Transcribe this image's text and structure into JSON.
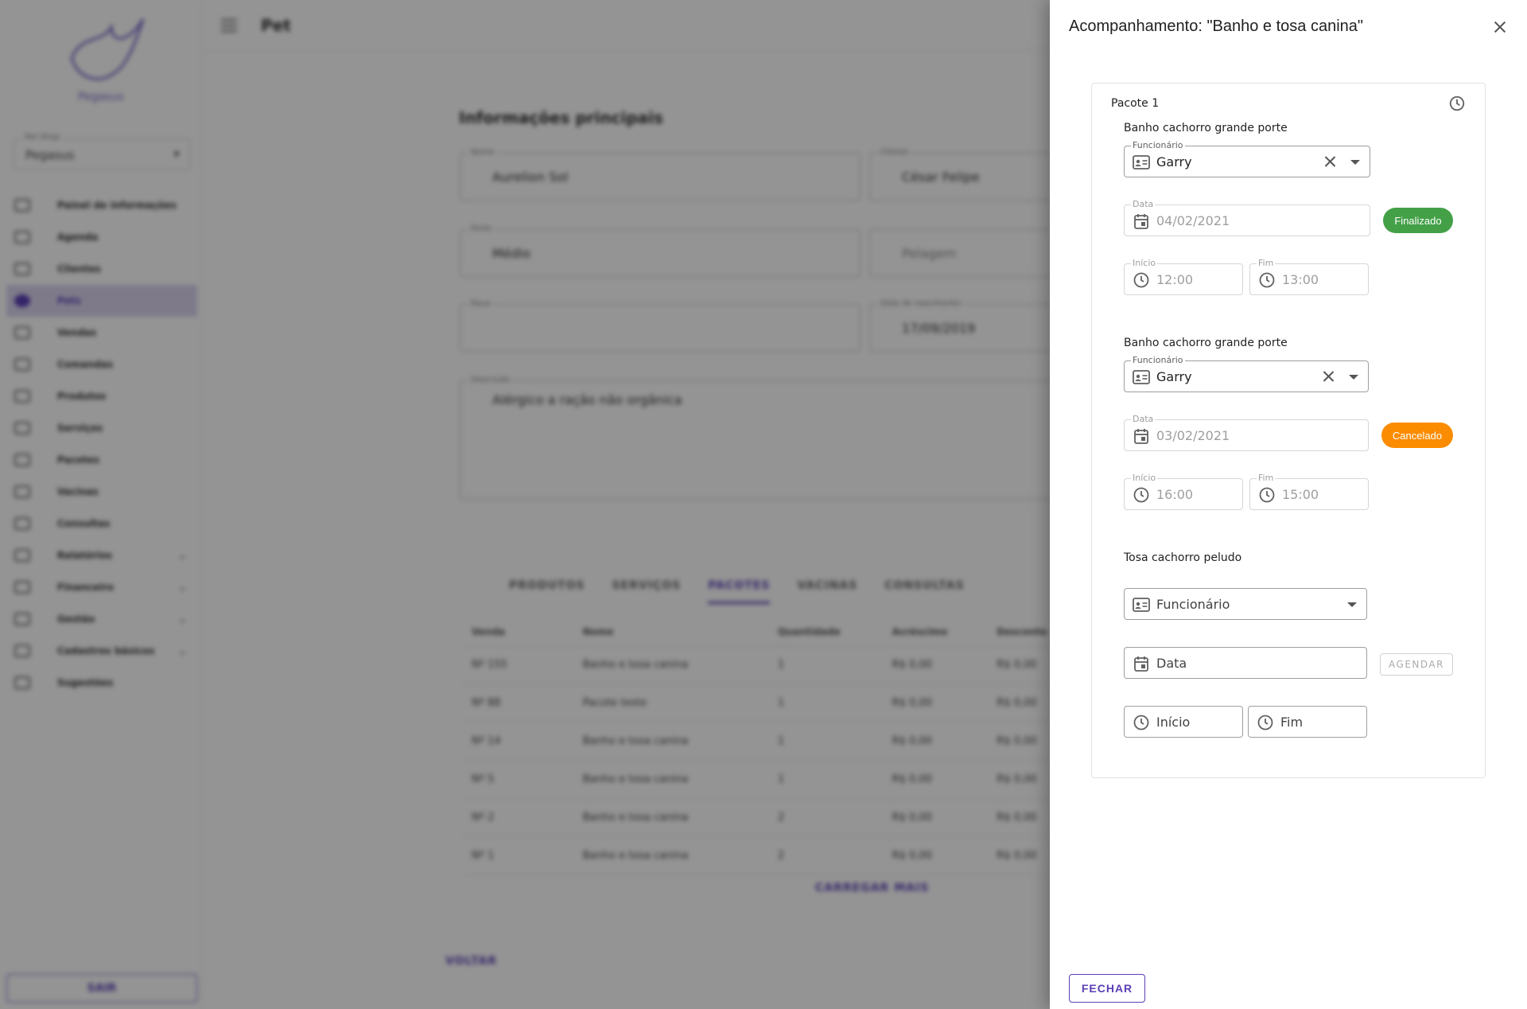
{
  "background": {
    "page_title": "Pet",
    "logo_text": "Pegasus",
    "shop_select": {
      "label": "Pet Shop",
      "value": "Pegasus"
    },
    "nav": [
      {
        "label": "Painel de informações",
        "active": false,
        "expandable": false
      },
      {
        "label": "Agenda",
        "active": false,
        "expandable": false
      },
      {
        "label": "Clientes",
        "active": false,
        "expandable": false
      },
      {
        "label": "Pets",
        "active": true,
        "expandable": false
      },
      {
        "label": "Vendas",
        "active": false,
        "expandable": false
      },
      {
        "label": "Comandas",
        "active": false,
        "expandable": false
      },
      {
        "label": "Produtos",
        "active": false,
        "expandable": false
      },
      {
        "label": "Serviços",
        "active": false,
        "expandable": false
      },
      {
        "label": "Pacotes",
        "active": false,
        "expandable": false
      },
      {
        "label": "Vacinas",
        "active": false,
        "expandable": false
      },
      {
        "label": "Consultas",
        "active": false,
        "expandable": false
      },
      {
        "label": "Relatórios",
        "active": false,
        "expandable": true
      },
      {
        "label": "Financeiro",
        "active": false,
        "expandable": true
      },
      {
        "label": "Gestão",
        "active": false,
        "expandable": true
      },
      {
        "label": "Cadastros básicos",
        "active": false,
        "expandable": true
      },
      {
        "label": "Sugestões",
        "active": false,
        "expandable": false
      }
    ],
    "sair_label": "SAIR",
    "section_title": "Informações principais",
    "fields": {
      "nome": {
        "label": "Nome",
        "value": "Aurelion Sol"
      },
      "cliente": {
        "label": "Cliente",
        "value": "César Felipe"
      },
      "porte": {
        "label": "Porte",
        "value": "Médio"
      },
      "pelagem": {
        "label": "",
        "value": "Pelagem"
      },
      "raca": {
        "label": "Raça",
        "value": ""
      },
      "nascimento": {
        "label": "Data de nascimento",
        "value": "17/09/2019"
      },
      "descricao": {
        "label": "Descrição",
        "value": "Alérgico a ração não orgânica"
      }
    },
    "tabs": [
      {
        "label": "PRODUTOS",
        "active": false
      },
      {
        "label": "SERVIÇOS",
        "active": false
      },
      {
        "label": "PACOTES",
        "active": true
      },
      {
        "label": "VACINAS",
        "active": false
      },
      {
        "label": "CONSULTAS",
        "active": false
      }
    ],
    "table": {
      "headers": [
        "Venda",
        "Nome",
        "Quantidade",
        "Acréscimo",
        "Desconto"
      ],
      "rows": [
        [
          "Nº 155",
          "Banho e tosa canina",
          "1",
          "R$ 0,00",
          "R$ 0,00"
        ],
        [
          "Nº 88",
          "Pacote teste",
          "1",
          "R$ 0,00",
          "R$ 0,00"
        ],
        [
          "Nº 14",
          "Banho e tosa canina",
          "1",
          "R$ 0,00",
          "R$ 0,00"
        ],
        [
          "Nº 5",
          "Banho e tosa canina",
          "1",
          "R$ 0,00",
          "R$ 0,00"
        ],
        [
          "Nº 2",
          "Banho e tosa canina",
          "2",
          "R$ 0,00",
          "R$ 0,00"
        ],
        [
          "Nº 1",
          "Banho e tosa canina",
          "2",
          "R$ 0,00",
          "R$ 0,00"
        ]
      ]
    },
    "carregar_label": "CARREGAR MAIS",
    "voltar_label": "VOLTAR"
  },
  "drawer": {
    "title": "Acompanhamento: \"Banho e tosa canina\"",
    "package_title": "Pacote 1",
    "services": [
      {
        "title": "Banho cachorro grande porte",
        "funcionario_label": "Funcionário",
        "funcionario_value": "Garry",
        "data_label": "Data",
        "data_value": "04/02/2021",
        "status": "Finalizado",
        "status_color": "#43a047",
        "inicio_label": "Início",
        "inicio_value": "12:00",
        "fim_label": "Fim",
        "fim_value": "13:00"
      },
      {
        "title": "Banho cachorro grande porte",
        "funcionario_label": "Funcionário",
        "funcionario_value": "Garry",
        "data_label": "Data",
        "data_value": "03/02/2021",
        "status": "Cancelado",
        "status_color": "#fb8c00",
        "inicio_label": "Início",
        "inicio_value": "16:00",
        "fim_label": "Fim",
        "fim_value": "15:00"
      },
      {
        "title": "Tosa cachorro peludo",
        "funcionario_placeholder": "Funcionário",
        "data_placeholder": "Data",
        "inicio_placeholder": "Início",
        "fim_placeholder": "Fim",
        "agendar_label": "AGENDAR"
      }
    ],
    "fechar_label": "FECHAR"
  },
  "colors": {
    "primary": "#5b3fb5",
    "finalizado": "#43a047",
    "cancelado": "#fb8c00"
  }
}
